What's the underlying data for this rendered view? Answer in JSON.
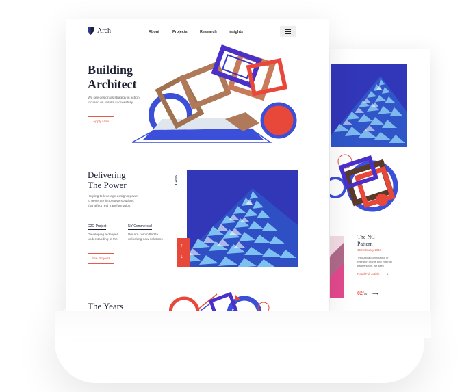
{
  "brand": {
    "name": "Arch"
  },
  "nav": {
    "links": [
      "About",
      "Projects",
      "Research",
      "Insights"
    ],
    "menu_icon": "hamburger-icon"
  },
  "hero": {
    "title_line1": "Building",
    "title_line2": "Architect",
    "desc_line1": "We see design as strategy in action,",
    "desc_line2": "focused on results successfully.",
    "cta": "Apply Now"
  },
  "section2": {
    "title_line1": "Delivering",
    "title_line2": "The Power",
    "desc_line1": "Helping to leverage design's power",
    "desc_line2": "to generate innovative solutions",
    "desc_line3": "that affect real transformation.",
    "col1_title": "C2O Project",
    "col1_desc_line1": "Developing a deeper",
    "col1_desc_line2": "understanding of the",
    "col2_title": "NY Commercial",
    "col2_desc_line1": "We are committed to",
    "col2_desc_line2": "unlocking new solutions",
    "cta": "See Projects",
    "counter": "02/05"
  },
  "section3": {
    "title": "The Years"
  },
  "side_page": {
    "title_line1": "The NC",
    "title_line2": "Pattern",
    "date": "15 February 2019",
    "desc_line1": "Through a combination of",
    "desc_line2": "research grants and external",
    "desc_line3": "partnerships, we seek",
    "link": "Read Full Article",
    "counter_current": "02/",
    "counter_total": "10"
  },
  "colors": {
    "accent": "#e8483a",
    "blue": "#3b36c8",
    "navy": "#1e2233"
  }
}
